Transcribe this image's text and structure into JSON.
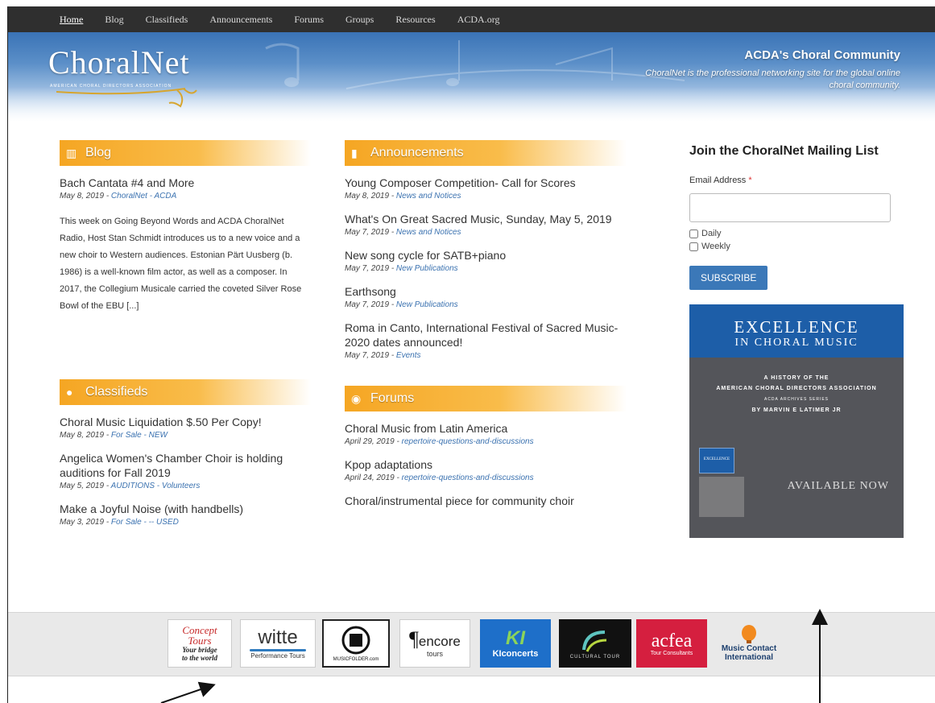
{
  "nav": [
    "Home",
    "Blog",
    "Classifieds",
    "Announcements",
    "Forums",
    "Groups",
    "Resources",
    "ACDA.org"
  ],
  "banner": {
    "logo": "ChoralNet",
    "logo_sub": "AMERICAN CHORAL DIRECTORS ASSOCIATION",
    "tagline_title": "ACDA's Choral Community",
    "tagline_text": "ChoralNet is the professional networking site for the global online choral community."
  },
  "blog": {
    "heading": "Blog",
    "posts": [
      {
        "title": "Bach Cantata #4 and More",
        "date": "May 8, 2019 - ",
        "cat": "ChoralNet - ACDA",
        "excerpt": "This week on Going Beyond Words and ACDA ChoralNet Radio, Host Stan Schmidt introduces us to a new voice and a new choir to Western audiences. Estonian Pärt Uusberg (b. 1986) is a well-known film actor, as well as a composer. In 2017, the Collegium Musicale carried the coveted Silver Rose Bowl of the EBU [...]"
      }
    ]
  },
  "classifieds": {
    "heading": "Classifieds",
    "posts": [
      {
        "title": "Choral Music Liquidation $.50 Per Copy!",
        "date": "May 8, 2019 - ",
        "cat": "For Sale - NEW"
      },
      {
        "title": "Angelica Women's Chamber Choir is holding auditions for Fall 2019",
        "date": "May 5, 2019 - ",
        "cat": "AUDITIONS - Volunteers"
      },
      {
        "title": "Make a Joyful Noise (with handbells)",
        "date": "May 3, 2019 - ",
        "cat": "For Sale - -- USED"
      }
    ]
  },
  "announcements": {
    "heading": "Announcements",
    "posts": [
      {
        "title": "Young Composer Competition- Call for Scores",
        "date": "May 8, 2019 - ",
        "cat": "News and Notices"
      },
      {
        "title": "What's On Great Sacred Music, Sunday, May 5, 2019",
        "date": "May 7, 2019 - ",
        "cat": "News and Notices"
      },
      {
        "title": "New song cycle for SATB+piano",
        "date": "May 7, 2019 - ",
        "cat": "New Publications"
      },
      {
        "title": "Earthsong",
        "date": "May 7, 2019 - ",
        "cat": "New Publications"
      },
      {
        "title": "Roma in Canto, International Festival of Sacred Music- 2020 dates announced!",
        "date": "May 7, 2019 - ",
        "cat": "Events"
      }
    ]
  },
  "forums": {
    "heading": "Forums",
    "posts": [
      {
        "title": "Choral Music from Latin America",
        "date": "April 29, 2019 - ",
        "cat": "repertoire-questions-and-discussions"
      },
      {
        "title": "Kpop adaptations",
        "date": "April 24, 2019 - ",
        "cat": "repertoire-questions-and-discussions"
      },
      {
        "title": "Choral/instrumental piece for community choir",
        "date": "",
        "cat": ""
      }
    ]
  },
  "mailing": {
    "title": "Join the ChoralNet Mailing List",
    "email_label": "Email Address",
    "required_mark": "*",
    "email_value": "",
    "options": [
      "Daily",
      "Weekly"
    ],
    "subscribe": "SUBSCRIBE"
  },
  "ad": {
    "title": "Excellence",
    "subtitle": "In Choral Music",
    "line1": "A History of the",
    "line2": "American Choral Directors Association",
    "line3": "ACDA Archives Series",
    "line4": "by Marvin E Latimer Jr",
    "book_label": "EXCELLENCE",
    "available": "Available Now"
  },
  "sponsors": {
    "concept": {
      "l1": "Concept",
      "l2": "Tours",
      "l3": "Your bridge",
      "l4": "to the world"
    },
    "witte": {
      "name": "witte",
      "sub": "Performance Tours"
    },
    "musicfolder": {
      "name": "MUSICFOLDER.com"
    },
    "encore": {
      "name": "encore",
      "sub": "tours"
    },
    "kiconcerts": {
      "name": "KIconcerts"
    },
    "cultural": {
      "name": "CULTURAL TOUR"
    },
    "acfea": {
      "name": "acfea",
      "sub": "Tour Consultants"
    },
    "musiccontact": {
      "l1": "Music Contact",
      "l2": "International"
    }
  },
  "colors": {
    "nav_bg": "#2f2f2f",
    "accent_orange": "#f5a623",
    "link_blue": "#3b72b0",
    "button_blue": "#3b78b8",
    "ad_gray": "#54555a"
  }
}
